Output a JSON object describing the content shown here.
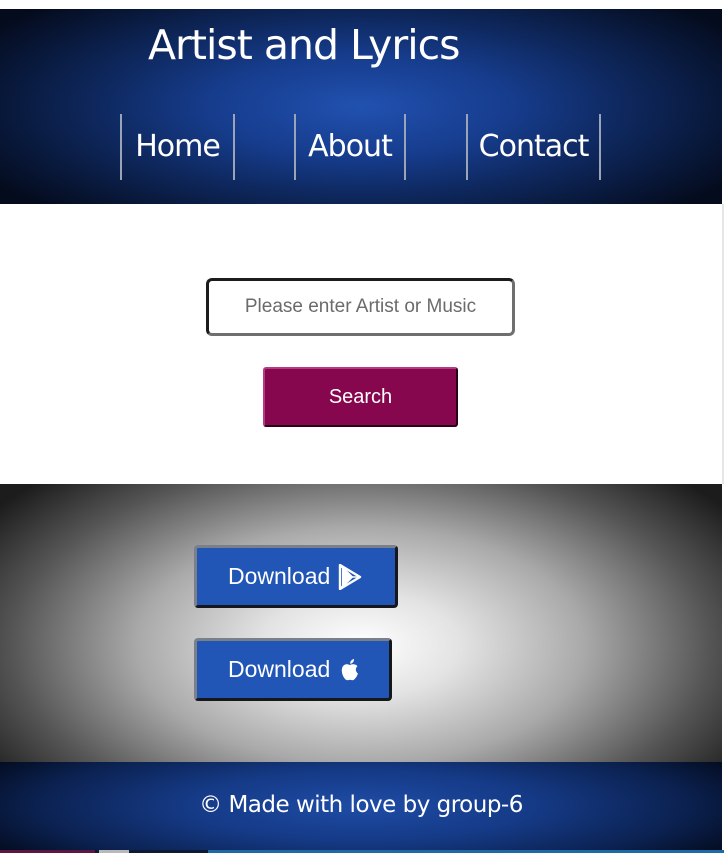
{
  "header": {
    "title": "Artist and Lyrics",
    "nav": [
      {
        "label": "Home"
      },
      {
        "label": "About"
      },
      {
        "label": "Contact"
      }
    ]
  },
  "search": {
    "placeholder": "Please enter Artist or Music",
    "value": "",
    "button_label": "Search"
  },
  "downloads": [
    {
      "label": "Download",
      "icon": "google-play-icon"
    },
    {
      "label": "Download",
      "icon": "apple-icon"
    }
  ],
  "footer": {
    "text": "© Made with love by group-6"
  },
  "colors": {
    "header_blue": "#163c8c",
    "search_button": "#87074f",
    "download_button": "#2156b7"
  }
}
